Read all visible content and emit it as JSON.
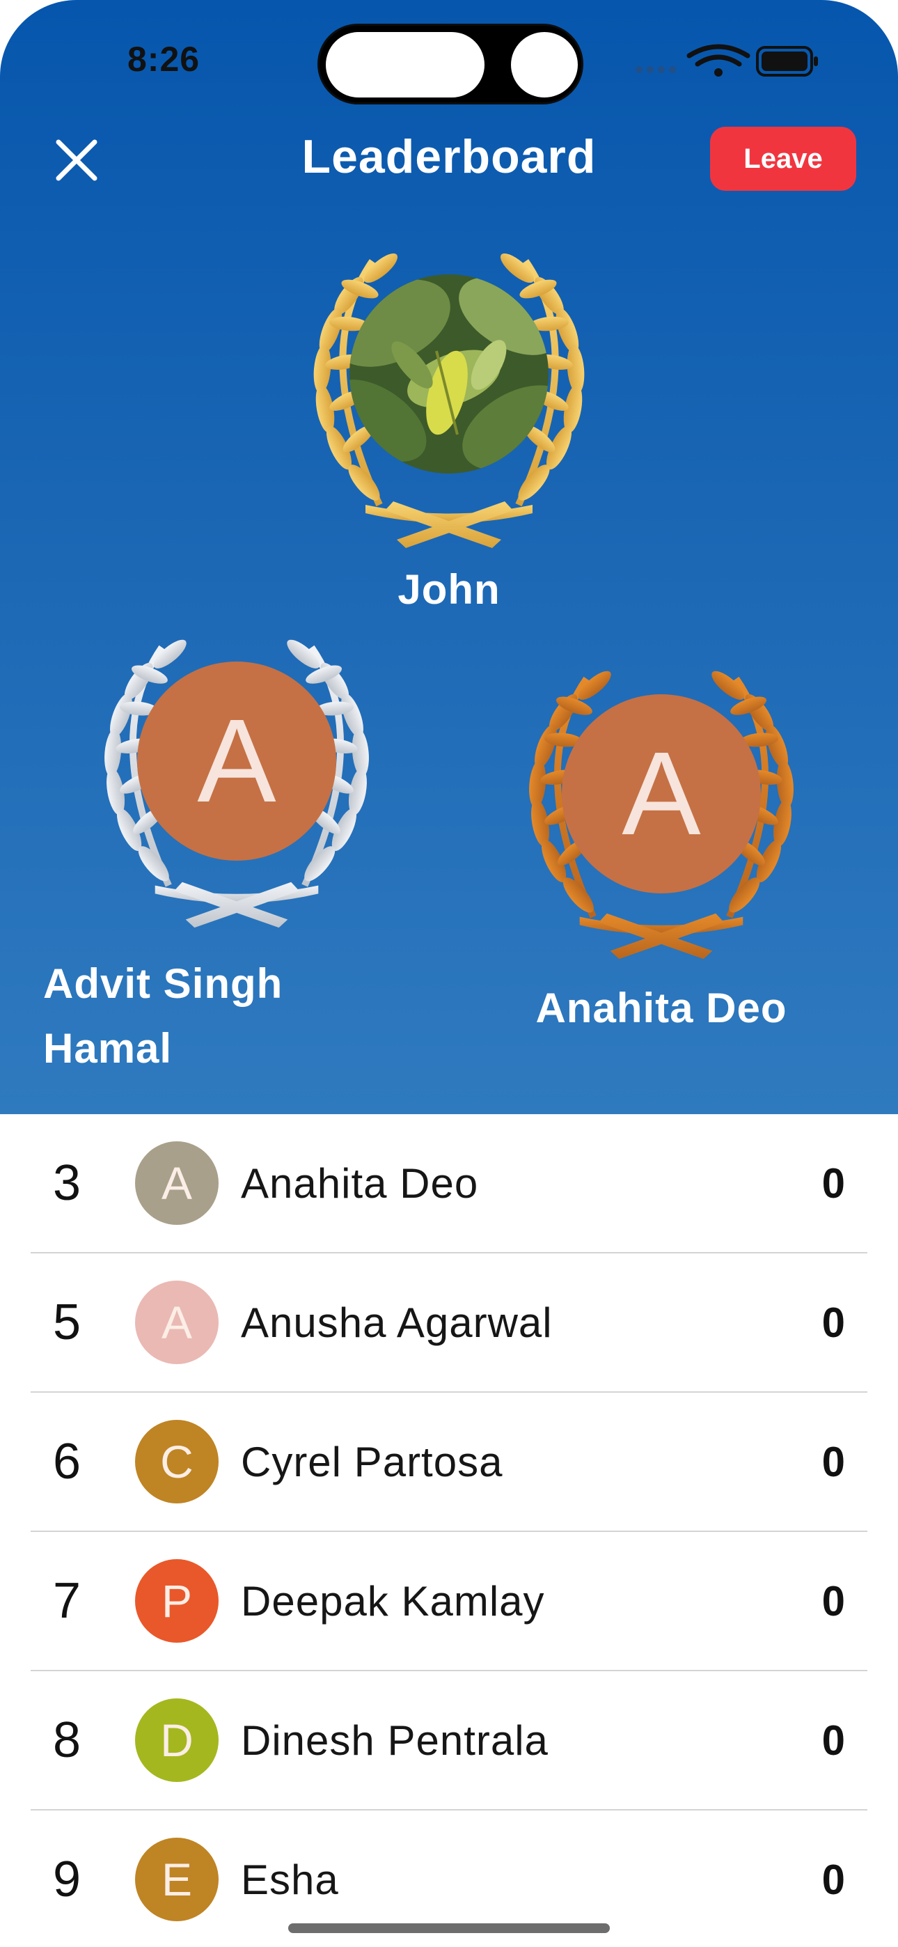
{
  "status_bar": {
    "time": "8:26"
  },
  "nav": {
    "title": "Leaderboard",
    "leave_label": "Leave"
  },
  "podium": {
    "first": {
      "name": "John"
    },
    "second": {
      "name_line1": "Advit Singh",
      "name_line2": "Hamal",
      "initial": "A"
    },
    "third": {
      "name": "Anahita Deo",
      "initial": "A"
    }
  },
  "colors": {
    "header_top": "#0656ad",
    "header_bottom": "#2f7abf",
    "leave_button": "#f1353f",
    "gold": "#e3b44b",
    "silver": "#d4d9e0",
    "bronze": "#c77523",
    "podium_avatar": "#c57145"
  },
  "leaderboard": [
    {
      "rank": "3",
      "initial": "A",
      "name": "Anahita Deo",
      "score": "0",
      "color": "#a8a08a"
    },
    {
      "rank": "5",
      "initial": "A",
      "name": "Anusha Agarwal",
      "score": "0",
      "color": "#eab9b4"
    },
    {
      "rank": "6",
      "initial": "C",
      "name": "Cyrel Partosa",
      "score": "0",
      "color": "#bf8424"
    },
    {
      "rank": "7",
      "initial": "P",
      "name": "Deepak Kamlay",
      "score": "0",
      "color": "#e9582a"
    },
    {
      "rank": "8",
      "initial": "D",
      "name": "Dinesh Pentrala",
      "score": "0",
      "color": "#a4b71f"
    },
    {
      "rank": "9",
      "initial": "E",
      "name": "Esha",
      "score": "0",
      "color": "#bf8424"
    }
  ]
}
